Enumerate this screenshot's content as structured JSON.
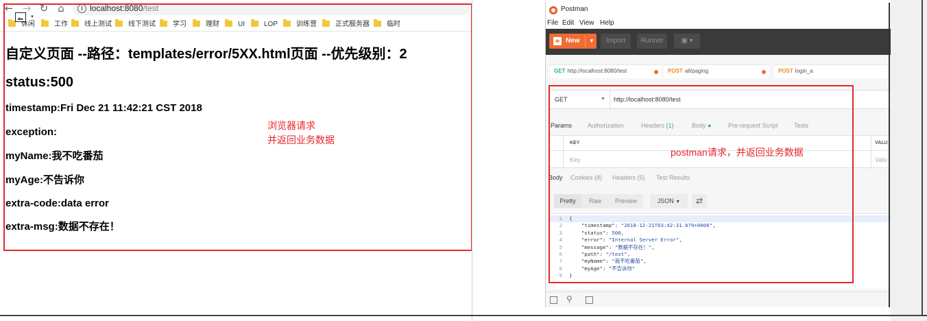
{
  "browser": {
    "address": {
      "host": "localhost:8080",
      "path": "/test"
    },
    "bookmarks": [
      "休闲",
      "工作",
      "线上测试",
      "线下测试",
      "学习",
      "理财",
      "UI",
      "LOP",
      "训练营",
      "正式服务器",
      "临时"
    ],
    "page_lines": [
      "自定义页面 --路径：templates/error/5XX.html页面 --优先级别：2",
      "status:500",
      "timestamp:Fri Dec 21 11:42:21 CST 2018",
      "exception:",
      "myName:我不吃番茄",
      "myAge:不告诉你",
      "extra-code:data error",
      "extra-msg:数据不存在！"
    ]
  },
  "annotations": {
    "browser_note": [
      "浏览器请求",
      "并返回业务数据"
    ],
    "postman_note": "postman请求，并返回业务数据",
    "color": "#e8262a"
  },
  "postman": {
    "title": "Postman",
    "menu": [
      "File",
      "Edit",
      "View",
      "Help"
    ],
    "toolbar": {
      "new_label": "New",
      "import_label": "Import",
      "runner_label": "Runner"
    },
    "tabs": [
      {
        "method": "GET",
        "label": "http://localhost:8080/test"
      },
      {
        "method": "POST",
        "label": "all/paging"
      },
      {
        "method": "POST",
        "label": "login_a"
      }
    ],
    "request": {
      "method": "GET",
      "url": "http://localhost:8080/test"
    },
    "request_tabs": {
      "params": "Params",
      "authorization": "Authorization",
      "headers": "Headers",
      "headers_count": "(1)",
      "body": "Body",
      "prerequest": "Pre-request Script",
      "tests": "Tests"
    },
    "params_table": {
      "key_header": "KEY",
      "value_header": "VALU",
      "key_placeholder": "Key",
      "value_placeholder": "Valu"
    },
    "response_tabs": {
      "body": "Body",
      "cookies": "Cookies (8)",
      "headers": "Headers (5)",
      "test_results": "Test Results"
    },
    "view_buttons": {
      "pretty": "Pretty",
      "raw": "Raw",
      "preview": "Preview",
      "format": "JSON"
    },
    "code": [
      {
        "n": "1",
        "parts": [
          [
            "k",
            "{"
          ]
        ]
      },
      {
        "n": "2",
        "parts": [
          [
            "k",
            "    \"timestamp\": "
          ],
          [
            "s",
            "\"2018-12-21T03:42:31.679+0000\""
          ],
          [
            "k",
            ","
          ]
        ]
      },
      {
        "n": "3",
        "parts": [
          [
            "k",
            "    \"status\": "
          ],
          [
            "n",
            "500"
          ],
          [
            "k",
            ","
          ]
        ]
      },
      {
        "n": "4",
        "parts": [
          [
            "k",
            "    \"error\": "
          ],
          [
            "s",
            "\"Internal Server Error\""
          ],
          [
            "k",
            ","
          ]
        ]
      },
      {
        "n": "5",
        "parts": [
          [
            "k",
            "    \"message\": "
          ],
          [
            "s",
            "\"数据不存在！\""
          ],
          [
            "k",
            ","
          ]
        ]
      },
      {
        "n": "6",
        "parts": [
          [
            "k",
            "    \"path\": "
          ],
          [
            "s",
            "\"/test\""
          ],
          [
            "k",
            ","
          ]
        ]
      },
      {
        "n": "7",
        "parts": [
          [
            "k",
            "    \"myName\": "
          ],
          [
            "s",
            "\"我不吃番茄\""
          ],
          [
            "k",
            ","
          ]
        ]
      },
      {
        "n": "8",
        "parts": [
          [
            "k",
            "    \"myAge\": "
          ],
          [
            "s",
            "\"不告诉你\""
          ]
        ]
      },
      {
        "n": "9",
        "parts": [
          [
            "k",
            "}"
          ]
        ]
      }
    ]
  },
  "colors": {
    "postman_orange": "#ef6c33",
    "postman_dark": "#3a3a3a",
    "headers_green": "#26b47f",
    "json_value": "#2b4ba8"
  }
}
